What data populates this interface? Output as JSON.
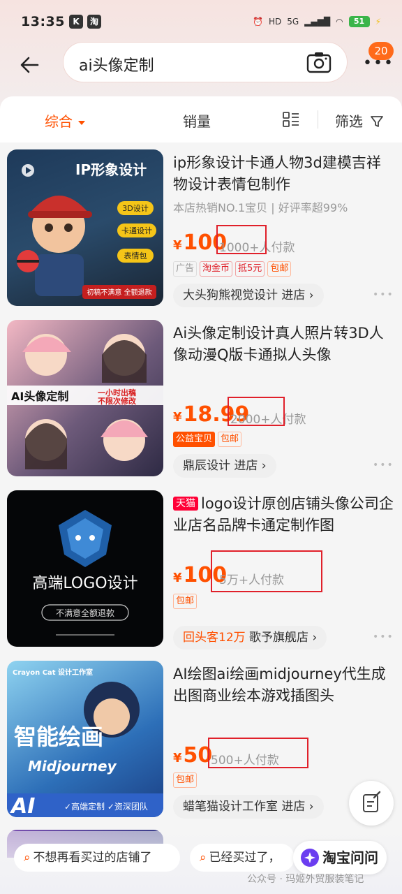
{
  "status": {
    "time": "13:35",
    "k_label": "K",
    "taobao_label": "淘",
    "hd": "HD",
    "signal": "5G",
    "battery": "51"
  },
  "search": {
    "query": "ai头像定制",
    "notification_count": "20"
  },
  "tabs": {
    "general": "综合",
    "sales": "销量",
    "filter": "筛选"
  },
  "products": [
    {
      "title": "ip形象设计卡通人物3d建模吉祥物设计表情包制作",
      "subtitle": "本店热销NO.1宝贝 | 好评率超99%",
      "currency": "¥",
      "price": "100",
      "sold": "1000+人付款",
      "tags": [
        "广告",
        "淘金币",
        "抵5元",
        "包邮"
      ],
      "shop": "大头狗熊视觉设计 进店 ›",
      "thumb_title": "IP形象设计",
      "thumb_pills": [
        "3D设计",
        "卡通设计",
        "表情包"
      ],
      "thumb_bottom": "初稿不满意 全额退款"
    },
    {
      "title": "Ai头像定制设计真人照片转3D人像动漫Q版卡通拟人头像",
      "currency": "¥",
      "price": "18.99",
      "sold": "2000+人付款",
      "tags": [
        "公益宝贝",
        "包邮"
      ],
      "shop": "鼎辰设计 进店 ›",
      "thumb_banner": "AI头像定制",
      "thumb_red1": "一小时出稿",
      "thumb_red2": "不限次修改"
    },
    {
      "tmall": "天猫",
      "title": "logo设计原创店铺头像公司企业店名品牌卡通定制作图",
      "currency": "¥",
      "price": "100",
      "sold": "5万+人付款",
      "tags": [
        "包邮"
      ],
      "shop_highlight": "回头客12万",
      "shop": "歌予旗舰店 ›",
      "thumb_title": "高端LOGO设计",
      "thumb_bottom": "不满意全额退款"
    },
    {
      "title": "AI绘图ai绘画midjourney代生成出图商业绘本游戏插图头",
      "currency": "¥",
      "price": "50",
      "sold": "500+人付款",
      "tags": [
        "包邮"
      ],
      "shop": "蜡笔猫设计工作室 进店 ›",
      "thumb_brand": "Crayon Cat 设计工作室",
      "thumb_title": "智能绘画",
      "thumb_sub": "Midjourney",
      "thumb_ai": "AI",
      "thumb_checks": "✓高端定制 ✓资深团队"
    }
  ],
  "bottom": {
    "chip1": "不想再看买过的店铺了",
    "chip2": "已经买过了，",
    "ask": "淘宝问问",
    "watermark": "公众号 · 玛姬外贸服装笔记"
  },
  "colors": {
    "accent": "#ff5000",
    "highlight_box": "#e0202a"
  }
}
